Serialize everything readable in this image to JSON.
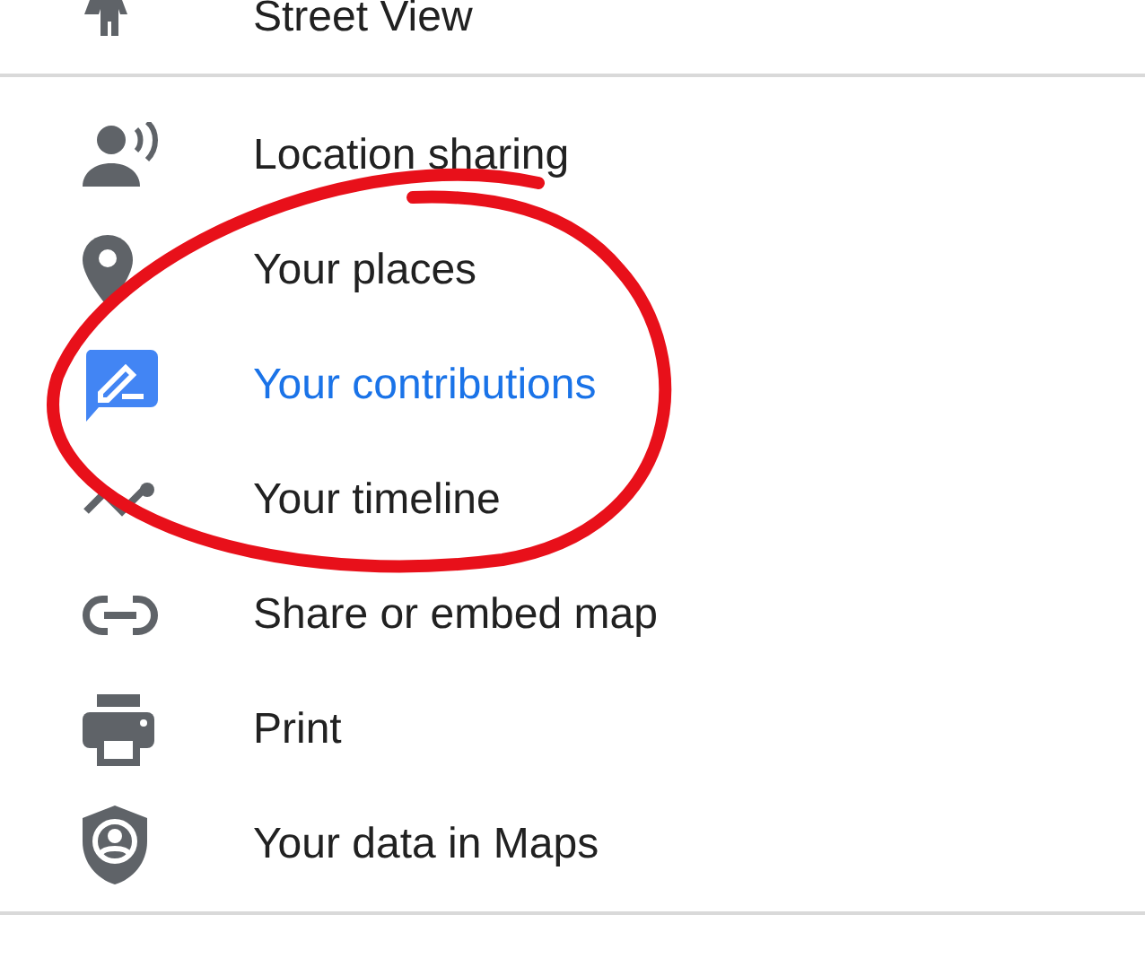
{
  "top_item": {
    "label": "Street View"
  },
  "menu_items": [
    {
      "label": "Location sharing",
      "selected": false
    },
    {
      "label": "Your places",
      "selected": false
    },
    {
      "label": "Your contributions",
      "selected": true
    },
    {
      "label": "Your timeline",
      "selected": false
    },
    {
      "label": "Share or embed map",
      "selected": false
    },
    {
      "label": "Print",
      "selected": false
    },
    {
      "label": "Your data in Maps",
      "selected": false
    }
  ],
  "annotation": {
    "kind": "ellipse"
  }
}
